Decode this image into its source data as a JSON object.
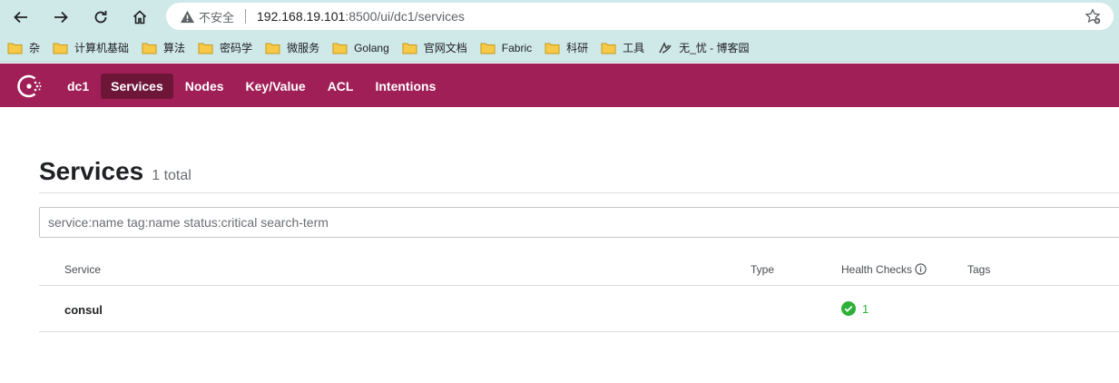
{
  "browser": {
    "insecure_label": "不安全",
    "url_host": "192.168.19.101",
    "url_rest": ":8500/ui/dc1/services",
    "bookmarks": [
      {
        "label": "杂",
        "icon": "folder-icon"
      },
      {
        "label": "计算机基础",
        "icon": "folder-icon"
      },
      {
        "label": "算法",
        "icon": "folder-icon"
      },
      {
        "label": "密码学",
        "icon": "folder-icon"
      },
      {
        "label": "微服务",
        "icon": "folder-icon"
      },
      {
        "label": "Golang",
        "icon": "folder-icon"
      },
      {
        "label": "官网文档",
        "icon": "folder-icon"
      },
      {
        "label": "Fabric",
        "icon": "folder-icon"
      },
      {
        "label": "科研",
        "icon": "folder-icon"
      },
      {
        "label": "工具",
        "icon": "folder-icon"
      },
      {
        "label": "无_忧 - 博客园",
        "icon": "cnblogs-icon"
      }
    ]
  },
  "header": {
    "brand_color": "#a01f57",
    "nav": [
      {
        "label": "dc1"
      },
      {
        "label": "Services"
      },
      {
        "label": "Nodes"
      },
      {
        "label": "Key/Value"
      },
      {
        "label": "ACL"
      },
      {
        "label": "Intentions"
      }
    ],
    "active": "Services"
  },
  "main": {
    "title": "Services",
    "count": "1 total",
    "search_placeholder": "service:name tag:name status:critical search-term",
    "columns": {
      "service": "Service",
      "type": "Type",
      "health": "Health Checks",
      "tags": "Tags"
    },
    "rows": [
      {
        "service": "consul",
        "type": "",
        "health_passing": "1",
        "tags": ""
      }
    ]
  }
}
